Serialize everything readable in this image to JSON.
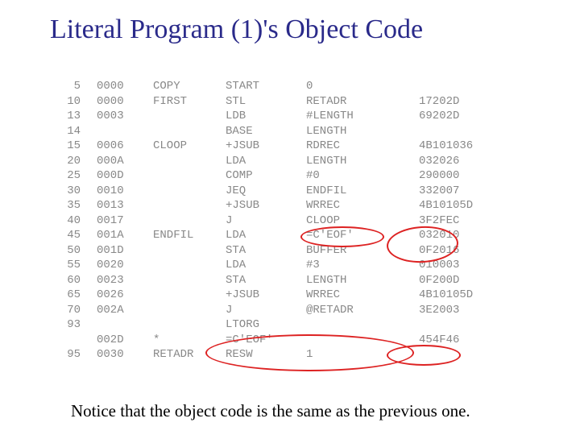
{
  "title": "Literal Program (1)'s Object Code",
  "footnote": "Notice that the object code is the same as the previous one.",
  "rows": [
    {
      "line": "5",
      "loc": "0000",
      "label": "COPY",
      "op": "START",
      "arg": "0",
      "obj": ""
    },
    {
      "line": "10",
      "loc": "0000",
      "label": "FIRST",
      "op": "STL",
      "arg": "RETADR",
      "obj": "17202D"
    },
    {
      "line": "13",
      "loc": "0003",
      "label": "",
      "op": "LDB",
      "arg": "#LENGTH",
      "obj": "69202D"
    },
    {
      "line": "14",
      "loc": "",
      "label": "",
      "op": "BASE",
      "arg": "LENGTH",
      "obj": ""
    },
    {
      "line": "15",
      "loc": "0006",
      "label": "CLOOP",
      "op": "+JSUB",
      "arg": "RDREC",
      "obj": "4B101036"
    },
    {
      "line": "20",
      "loc": "000A",
      "label": "",
      "op": "LDA",
      "arg": "LENGTH",
      "obj": "032026"
    },
    {
      "line": "25",
      "loc": "000D",
      "label": "",
      "op": "COMP",
      "arg": "#0",
      "obj": "290000"
    },
    {
      "line": "30",
      "loc": "0010",
      "label": "",
      "op": "JEQ",
      "arg": "ENDFIL",
      "obj": "332007"
    },
    {
      "line": "35",
      "loc": "0013",
      "label": "",
      "op": "+JSUB",
      "arg": "WRREC",
      "obj": "4B10105D"
    },
    {
      "line": "40",
      "loc": "0017",
      "label": "",
      "op": "J",
      "arg": "CLOOP",
      "obj": "3F2FEC"
    },
    {
      "line": "45",
      "loc": "001A",
      "label": "ENDFIL",
      "op": "LDA",
      "arg": "=C'EOF'",
      "obj": "032010"
    },
    {
      "line": "50",
      "loc": "001D",
      "label": "",
      "op": "STA",
      "arg": "BUFFER",
      "obj": "0F2016"
    },
    {
      "line": "55",
      "loc": "0020",
      "label": "",
      "op": "LDA",
      "arg": "#3",
      "obj": "010003"
    },
    {
      "line": "60",
      "loc": "0023",
      "label": "",
      "op": "STA",
      "arg": "LENGTH",
      "obj": "0F200D"
    },
    {
      "line": "65",
      "loc": "0026",
      "label": "",
      "op": "+JSUB",
      "arg": "WRREC",
      "obj": "4B10105D"
    },
    {
      "line": "70",
      "loc": "002A",
      "label": "",
      "op": "J",
      "arg": "@RETADR",
      "obj": "3E2003"
    },
    {
      "line": "93",
      "loc": "",
      "label": "",
      "op": "LTORG",
      "arg": "",
      "obj": ""
    },
    {
      "line": "",
      "loc": "002D",
      "label": "*",
      "op": "=C'EOF'",
      "arg": "",
      "obj": "454F46"
    },
    {
      "line": "95",
      "loc": "0030",
      "label": "RETADR",
      "op": "RESW",
      "arg": "1",
      "obj": ""
    }
  ]
}
